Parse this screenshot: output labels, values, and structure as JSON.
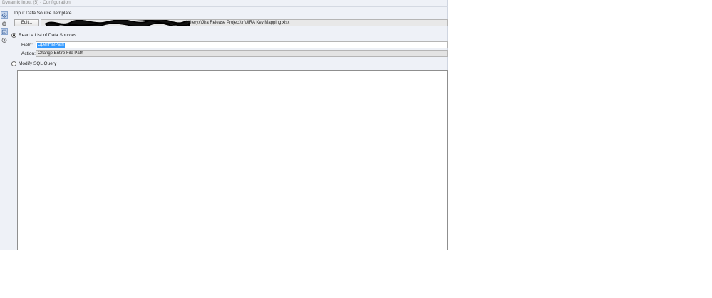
{
  "window": {
    "title": "Dynamic Input (5) - Configuration"
  },
  "rail": {
    "icons": [
      "gear-icon",
      "arrows-icon",
      "tag-icon",
      "help-icon"
    ],
    "active_color": "#c7d6ec"
  },
  "template_section": {
    "label": "Input Data Source Template",
    "edit_label": "Edit...",
    "path_value": "Alteryx\\Jira Release Project\\In\\JIRA Key Mapping.xlsx"
  },
  "read_list": {
    "label": "Read a List of Data Sources",
    "selected": true,
    "field_label": "Field:",
    "field_value": "OpenFilePath",
    "action_label": "Action:",
    "action_value": "Change Entire File Path"
  },
  "modify_sql": {
    "label": "Modify SQL Query",
    "selected": false
  }
}
